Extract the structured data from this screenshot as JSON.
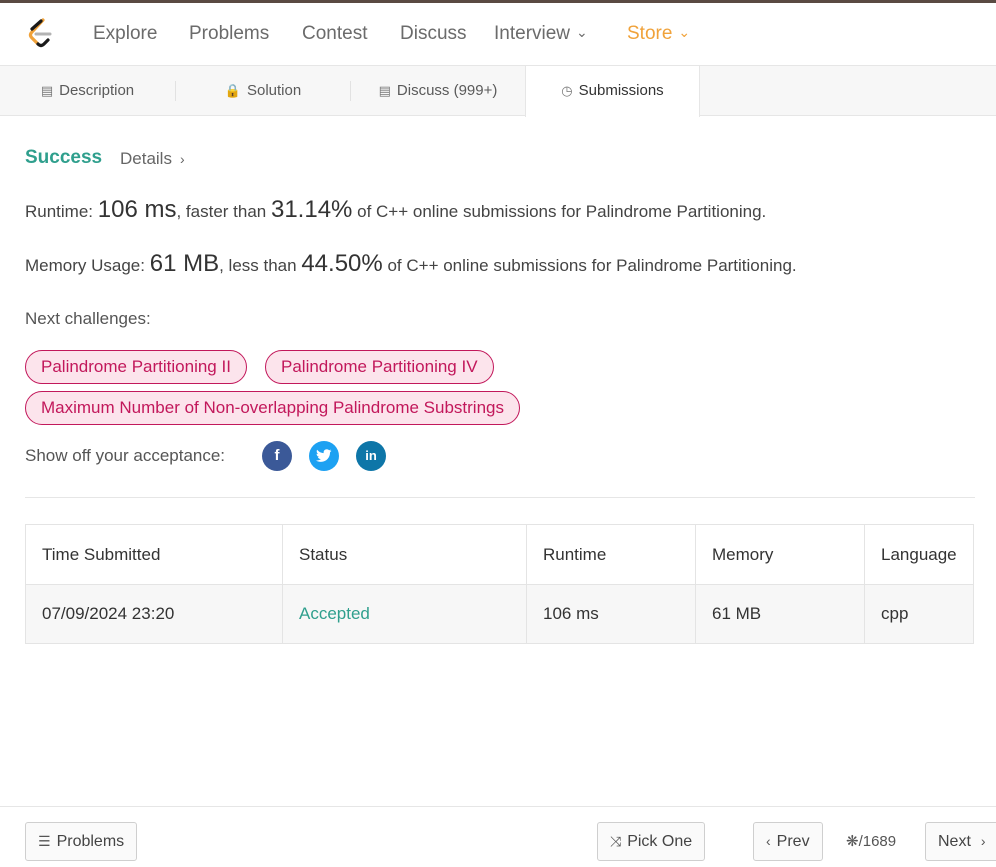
{
  "nav": {
    "items": [
      "Explore",
      "Problems",
      "Contest",
      "Discuss",
      "Interview"
    ],
    "store_label": "Store",
    "chevron": "⌄"
  },
  "tabs": [
    {
      "label": "Description",
      "icon": "document-icon"
    },
    {
      "label": "Solution",
      "icon": "lock-icon"
    },
    {
      "label": "Discuss (999+)",
      "icon": "comment-icon"
    },
    {
      "label": "Submissions",
      "icon": "clock-icon"
    }
  ],
  "result": {
    "status": "Success",
    "details_label": "Details"
  },
  "runtime": {
    "label": "Runtime:",
    "value": "106 ms",
    "mid": ", faster than",
    "percent": "31.14%",
    "suffix": "of C++ online submissions for Palindrome Partitioning."
  },
  "memory": {
    "label": "Memory Usage:",
    "value": "61 MB",
    "mid": ", less than",
    "percent": "44.50%",
    "suffix": "of C++ online submissions for Palindrome Partitioning."
  },
  "next_challenges": {
    "label": "Next challenges:",
    "items": [
      "Palindrome Partitioning II",
      "Palindrome Partitioning IV",
      "Maximum Number of Non-overlapping Palindrome Substrings"
    ]
  },
  "share": {
    "label": "Show off your acceptance:",
    "icons": [
      "facebook-icon",
      "twitter-icon",
      "linkedin-icon"
    ]
  },
  "table": {
    "headers": [
      "Time Submitted",
      "Status",
      "Runtime",
      "Memory",
      "Language"
    ],
    "rows": [
      [
        "07/09/2024 23:20",
        "Accepted",
        "106 ms",
        "61 MB",
        "cpp"
      ]
    ]
  },
  "footer": {
    "problems_label": "Problems",
    "pick_one_label": "Pick One",
    "prev_label": "Prev",
    "counter": "/1689",
    "next_label": "Next"
  },
  "colors": {
    "success": "#2f9f8d",
    "store": "#f0a23a",
    "pill_border": "#c2185b",
    "pill_bg": "#fce4ec"
  }
}
